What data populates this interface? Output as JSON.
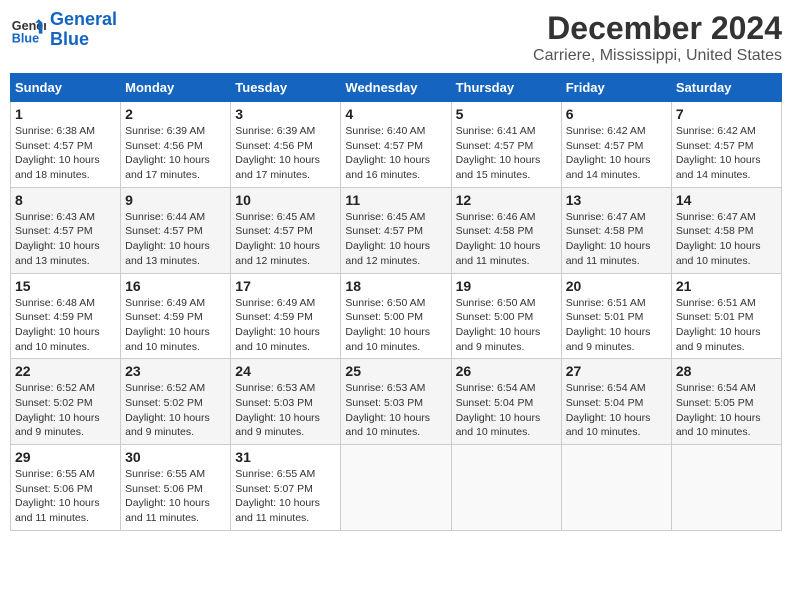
{
  "header": {
    "logo_line1": "General",
    "logo_line2": "Blue",
    "month": "December 2024",
    "location": "Carriere, Mississippi, United States"
  },
  "weekdays": [
    "Sunday",
    "Monday",
    "Tuesday",
    "Wednesday",
    "Thursday",
    "Friday",
    "Saturday"
  ],
  "weeks": [
    [
      {
        "day": "1",
        "sunrise": "6:38 AM",
        "sunset": "4:57 PM",
        "daylight": "10 hours and 18 minutes."
      },
      {
        "day": "2",
        "sunrise": "6:39 AM",
        "sunset": "4:56 PM",
        "daylight": "10 hours and 17 minutes."
      },
      {
        "day": "3",
        "sunrise": "6:39 AM",
        "sunset": "4:56 PM",
        "daylight": "10 hours and 17 minutes."
      },
      {
        "day": "4",
        "sunrise": "6:40 AM",
        "sunset": "4:57 PM",
        "daylight": "10 hours and 16 minutes."
      },
      {
        "day": "5",
        "sunrise": "6:41 AM",
        "sunset": "4:57 PM",
        "daylight": "10 hours and 15 minutes."
      },
      {
        "day": "6",
        "sunrise": "6:42 AM",
        "sunset": "4:57 PM",
        "daylight": "10 hours and 14 minutes."
      },
      {
        "day": "7",
        "sunrise": "6:42 AM",
        "sunset": "4:57 PM",
        "daylight": "10 hours and 14 minutes."
      }
    ],
    [
      {
        "day": "8",
        "sunrise": "6:43 AM",
        "sunset": "4:57 PM",
        "daylight": "10 hours and 13 minutes."
      },
      {
        "day": "9",
        "sunrise": "6:44 AM",
        "sunset": "4:57 PM",
        "daylight": "10 hours and 13 minutes."
      },
      {
        "day": "10",
        "sunrise": "6:45 AM",
        "sunset": "4:57 PM",
        "daylight": "10 hours and 12 minutes."
      },
      {
        "day": "11",
        "sunrise": "6:45 AM",
        "sunset": "4:57 PM",
        "daylight": "10 hours and 12 minutes."
      },
      {
        "day": "12",
        "sunrise": "6:46 AM",
        "sunset": "4:58 PM",
        "daylight": "10 hours and 11 minutes."
      },
      {
        "day": "13",
        "sunrise": "6:47 AM",
        "sunset": "4:58 PM",
        "daylight": "10 hours and 11 minutes."
      },
      {
        "day": "14",
        "sunrise": "6:47 AM",
        "sunset": "4:58 PM",
        "daylight": "10 hours and 10 minutes."
      }
    ],
    [
      {
        "day": "15",
        "sunrise": "6:48 AM",
        "sunset": "4:59 PM",
        "daylight": "10 hours and 10 minutes."
      },
      {
        "day": "16",
        "sunrise": "6:49 AM",
        "sunset": "4:59 PM",
        "daylight": "10 hours and 10 minutes."
      },
      {
        "day": "17",
        "sunrise": "6:49 AM",
        "sunset": "4:59 PM",
        "daylight": "10 hours and 10 minutes."
      },
      {
        "day": "18",
        "sunrise": "6:50 AM",
        "sunset": "5:00 PM",
        "daylight": "10 hours and 10 minutes."
      },
      {
        "day": "19",
        "sunrise": "6:50 AM",
        "sunset": "5:00 PM",
        "daylight": "10 hours and 9 minutes."
      },
      {
        "day": "20",
        "sunrise": "6:51 AM",
        "sunset": "5:01 PM",
        "daylight": "10 hours and 9 minutes."
      },
      {
        "day": "21",
        "sunrise": "6:51 AM",
        "sunset": "5:01 PM",
        "daylight": "10 hours and 9 minutes."
      }
    ],
    [
      {
        "day": "22",
        "sunrise": "6:52 AM",
        "sunset": "5:02 PM",
        "daylight": "10 hours and 9 minutes."
      },
      {
        "day": "23",
        "sunrise": "6:52 AM",
        "sunset": "5:02 PM",
        "daylight": "10 hours and 9 minutes."
      },
      {
        "day": "24",
        "sunrise": "6:53 AM",
        "sunset": "5:03 PM",
        "daylight": "10 hours and 9 minutes."
      },
      {
        "day": "25",
        "sunrise": "6:53 AM",
        "sunset": "5:03 PM",
        "daylight": "10 hours and 10 minutes."
      },
      {
        "day": "26",
        "sunrise": "6:54 AM",
        "sunset": "5:04 PM",
        "daylight": "10 hours and 10 minutes."
      },
      {
        "day": "27",
        "sunrise": "6:54 AM",
        "sunset": "5:04 PM",
        "daylight": "10 hours and 10 minutes."
      },
      {
        "day": "28",
        "sunrise": "6:54 AM",
        "sunset": "5:05 PM",
        "daylight": "10 hours and 10 minutes."
      }
    ],
    [
      {
        "day": "29",
        "sunrise": "6:55 AM",
        "sunset": "5:06 PM",
        "daylight": "10 hours and 11 minutes."
      },
      {
        "day": "30",
        "sunrise": "6:55 AM",
        "sunset": "5:06 PM",
        "daylight": "10 hours and 11 minutes."
      },
      {
        "day": "31",
        "sunrise": "6:55 AM",
        "sunset": "5:07 PM",
        "daylight": "10 hours and 11 minutes."
      },
      null,
      null,
      null,
      null
    ]
  ]
}
